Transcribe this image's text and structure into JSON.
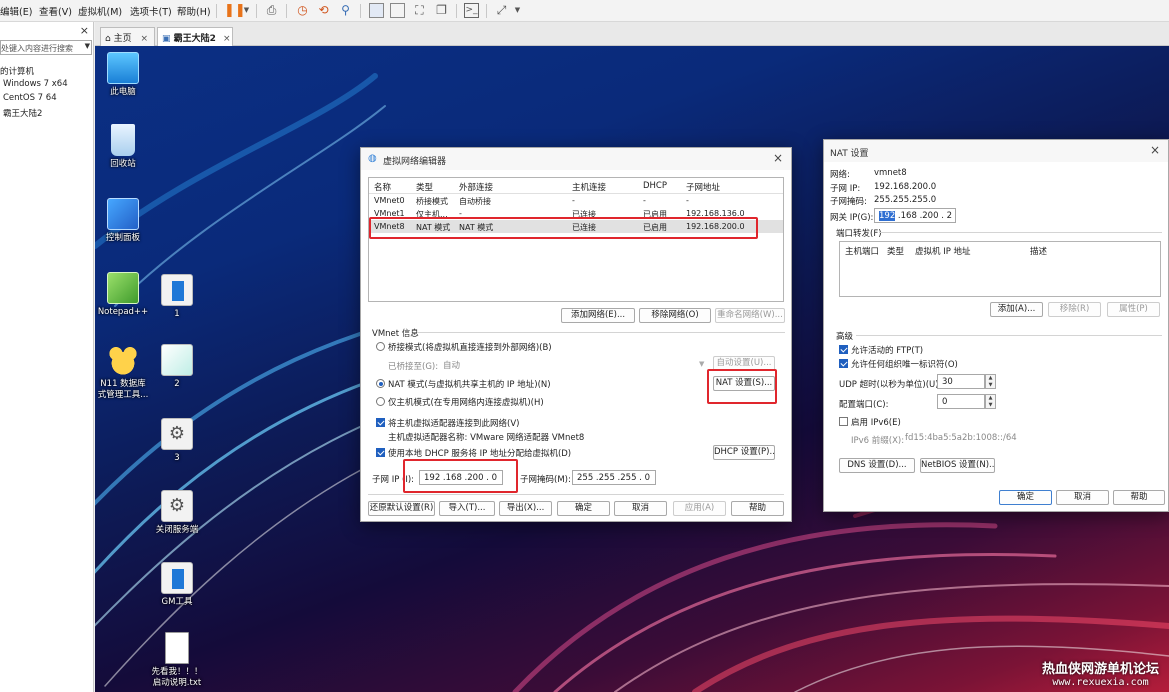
{
  "menubar": {
    "items": [
      "编辑(E)",
      "查看(V)",
      "虚拟机(M)",
      "选项卡(T)",
      "帮助(H)"
    ],
    "toolbar_icons": [
      "pause-icon",
      "dropdown-arrow-icon",
      "send-keys-icon",
      "snapshot-icon",
      "revert-snapshot-icon",
      "snapshot-manager-icon",
      "single-window-icon",
      "console-view-icon",
      "full-screen-icon",
      "unity-icon",
      "terminal-icon",
      "stretch-icon"
    ]
  },
  "sidebar": {
    "close": "×",
    "search_placeholder": "处键入内容进行搜索",
    "root": "的计算机",
    "vms": [
      "Windows 7 x64",
      "CentOS 7 64",
      "霸王大陆2"
    ]
  },
  "tabs": [
    {
      "label": "主页",
      "close": "×"
    },
    {
      "label": "霸王大陆2",
      "close": "×"
    }
  ],
  "desktop": {
    "icons": [
      "此电脑",
      "回收站",
      "控制面板",
      "Notepad++",
      "N11 数据库\n式管理工具...",
      "1",
      "2",
      "3",
      "关闭服务端",
      "GM工具",
      "先看我！！！\n启动说明.txt"
    ]
  },
  "vne": {
    "title": "虚拟网络编辑器",
    "close": "×",
    "table": {
      "headers": [
        "名称",
        "类型",
        "外部连接",
        "主机连接",
        "DHCP",
        "子网地址"
      ],
      "rows": [
        [
          "VMnet0",
          "桥接模式",
          "自动桥接",
          "-",
          "-",
          "-"
        ],
        [
          "VMnet1",
          "仅主机...",
          "-",
          "已连接",
          "已启用",
          "192.168.136.0"
        ],
        [
          "VMnet8",
          "NAT 模式",
          "NAT 模式",
          "已连接",
          "已启用",
          "192.168.200.0"
        ]
      ]
    },
    "buttons": {
      "add_network": "添加网络(E)...",
      "remove_network": "移除网络(O)",
      "rename_network": "重命名网络(W)...",
      "auto_settings": "自动设置(U)...",
      "nat_settings": "NAT 设置(S)...",
      "dhcp_settings": "DHCP 设置(P)...",
      "restore_defaults": "还原默认设置(R)",
      "import": "导入(T)...",
      "export": "导出(X)...",
      "ok": "确定",
      "cancel": "取消",
      "apply": "应用(A)",
      "help": "帮助"
    },
    "info_title": "VMnet 信息",
    "bridge_mode": "桥接模式(将虚拟机直接连接到外部网络)(B)",
    "bridged_to_label": "已桥接至(G):",
    "bridged_to_value": "自动",
    "nat_mode": "NAT 模式(与虚拟机共享主机的 IP 地址)(N)",
    "host_only_mode": "仅主机模式(在专用网络内连接虚拟机)(H)",
    "connect_adapter": "将主机虚拟适配器连接到此网络(V)",
    "adapter_name": "主机虚拟适配器名称: VMware 网络适配器 VMnet8",
    "use_dhcp": "使用本地 DHCP 服务将 IP 地址分配给虚拟机(D)",
    "subnet_ip_label": "子网 IP (I):",
    "subnet_ip_value": "192 .168 .200 . 0",
    "subnet_mask_label": "子网掩码(M):",
    "subnet_mask_value": "255 .255 .255 . 0"
  },
  "nat": {
    "title": "NAT 设置",
    "close": "×",
    "network_label": "网络:",
    "network_value": "vmnet8",
    "subnet_ip_label": "子网 IP:",
    "subnet_ip_value": "192.168.200.0",
    "subnet_mask_label": "子网掩码:",
    "subnet_mask_value": "255.255.255.0",
    "gateway_label": "网关 IP(G):",
    "gateway_sel": "192",
    "gateway_rest": " .168 .200 . 2",
    "port_forward_title": "端口转发(F)",
    "pf_headers": [
      "主机端口",
      "类型",
      "虚拟机 IP 地址",
      "描述"
    ],
    "pf_add": "添加(A)...",
    "pf_remove": "移除(R)",
    "pf_props": "属性(P)",
    "advanced_title": "高级",
    "allow_ftp": "允许活动的 FTP(T)",
    "allow_oui": "允许任何组织唯一标识符(O)",
    "udp_timeout_label": "UDP 超时(以秒为单位)(U):",
    "udp_timeout_value": "30",
    "config_port_label": "配置端口(C):",
    "config_port_value": "0",
    "enable_ipv6": "启用 IPv6(E)",
    "ipv6_prefix_label": "IPv6 前缀(X):",
    "ipv6_prefix_value": "fd15:4ba5:5a2b:1008::/64",
    "dns_settings": "DNS 设置(D)...",
    "netbios_settings": "NetBIOS 设置(N)...",
    "ok": "确定",
    "cancel": "取消",
    "help": "帮助"
  },
  "watermark": {
    "title": "热血侠网游单机论坛",
    "url": "www.rexuexia.com"
  }
}
